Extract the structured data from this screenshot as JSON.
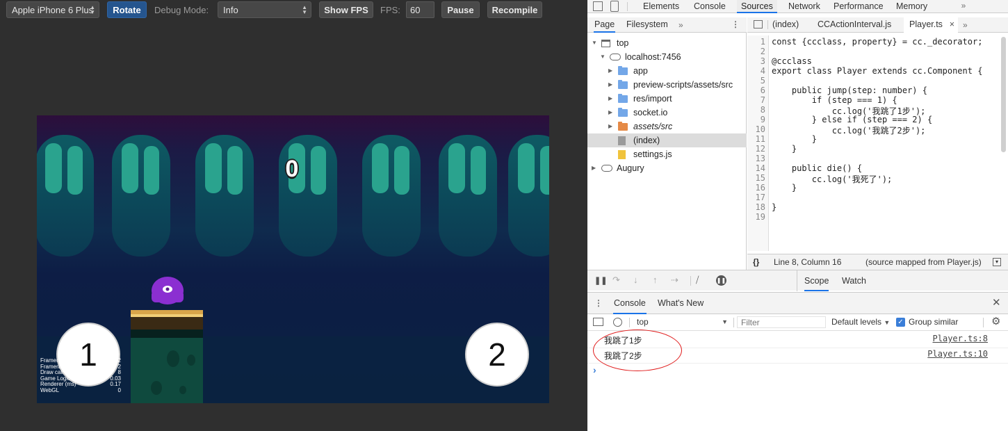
{
  "simulator": {
    "device": "Apple iPhone 6 Plus",
    "rotate_label": "Rotate",
    "debug_mode_label": "Debug Mode:",
    "debug_mode_value": "Info",
    "show_fps_label": "Show FPS",
    "fps_label": "FPS:",
    "fps_value": "60",
    "pause_label": "Pause",
    "recompile_label": "Recompile"
  },
  "game": {
    "score": "0",
    "touch_left": "1",
    "touch_right": "2",
    "stats": [
      {
        "label": "Framerat",
        "value": "2"
      },
      {
        "label": "Framerat",
        "value": "2"
      },
      {
        "label": "Draw call",
        "value": "8"
      },
      {
        "label": "Game Logic (ms)",
        "value": "0.03"
      },
      {
        "label": "Renderer (ms)",
        "value": "0.17"
      },
      {
        "label": "WebGL",
        "value": "0"
      }
    ],
    "colors": {
      "sky": "#2d0e3b",
      "mid": "#0f2a4d",
      "ground": "#0b1a3d",
      "blob": "#8b2fd1",
      "pillar": "#0f4a3e"
    }
  },
  "devtools": {
    "main_tabs": [
      "Elements",
      "Console",
      "Sources",
      "Network",
      "Performance",
      "Memory"
    ],
    "active_main_tab": "Sources",
    "more_tabs_icon": "chevron-double-right-icon",
    "navigator_tabs": [
      "Page",
      "Filesystem"
    ],
    "tree": [
      {
        "label": "top"
      },
      {
        "label": "localhost:7456"
      },
      {
        "label": "app"
      },
      {
        "label": "preview-scripts/assets/src"
      },
      {
        "label": "res/import"
      },
      {
        "label": "socket.io"
      },
      {
        "label": "assets/src"
      },
      {
        "label": "(index)"
      },
      {
        "label": "settings.js"
      },
      {
        "label": "Augury"
      }
    ],
    "editor_tabs": [
      {
        "label": "(index)"
      },
      {
        "label": "CCActionInterval.js"
      },
      {
        "label": "Player.ts"
      }
    ],
    "active_editor_tab": "Player.ts",
    "code_lines": [
      "const {ccclass, property} = cc._decorator;",
      "",
      "@ccclass",
      "export class Player extends cc.Component {",
      "",
      "    public jump(step: number) {",
      "        if (step === 1) {",
      "            cc.log('我跳了1步');",
      "        } else if (step === 2) {",
      "            cc.log('我跳了2步');",
      "        }",
      "    }",
      "",
      "    public die() {",
      "        cc.log('我死了');",
      "    }",
      "",
      "}",
      ""
    ],
    "status_position": "Line 8, Column 16",
    "status_source": "(source mapped from Player.js)",
    "scope_tabs": [
      "Scope",
      "Watch"
    ],
    "drawer_tabs": [
      "Console",
      "What's New"
    ],
    "console_context": "top",
    "filter_placeholder": "Filter",
    "levels_label": "Default levels",
    "group_similar_label": "Group similar",
    "messages": [
      {
        "text": "我跳了1步",
        "source": "Player.ts:8"
      },
      {
        "text": "我跳了2步",
        "source": "Player.ts:10"
      }
    ],
    "prompt": "›"
  }
}
